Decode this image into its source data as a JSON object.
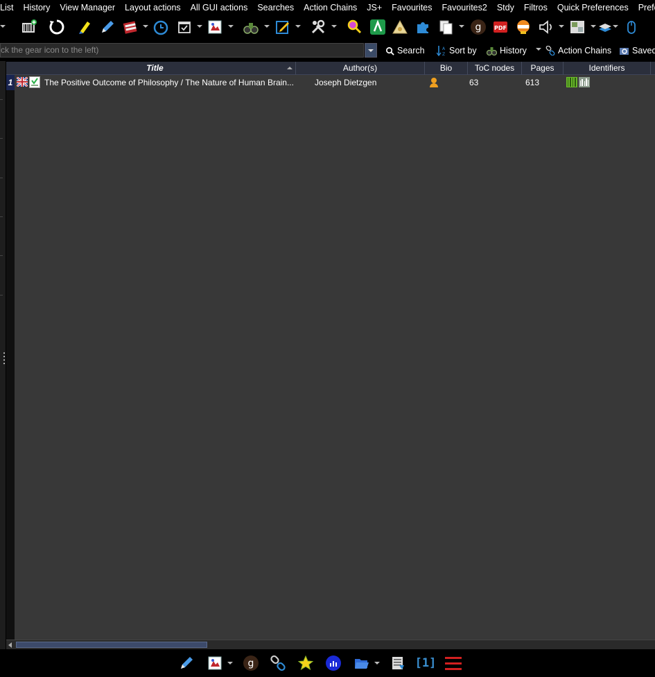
{
  "menu": [
    "List",
    "History",
    "View Manager",
    "Layout actions",
    "All GUI actions",
    "Searches",
    "Action Chains",
    "JS+",
    "Favourites",
    "Favourites2",
    "Stdy",
    "Filtros",
    "Quick Preferences",
    "Preferences"
  ],
  "toolbar": {
    "icons": [
      "add-barcode-icon",
      "refresh-icon",
      "highlighter-icon",
      "pencil-icon",
      "books-icon",
      "clock-icon",
      "calendar-check-icon",
      "image-gallery-icon",
      "binoculars-icon",
      "edit-note-icon",
      "tools-icon",
      "magnifier-icon",
      "green-app-icon",
      "warning-triangle-icon",
      "puzzle-icon",
      "copy-pages-icon",
      "goodreads-icon",
      "pdf-icon",
      "badge-icon",
      "speaker-icon",
      "image-thumbnail-icon",
      "layers-icon",
      "mouse-icon"
    ],
    "pdf_label": "PDF",
    "goodreads_label": "g"
  },
  "search": {
    "placeholder": "ck the gear icon to the left)",
    "search_label": "Search",
    "sort_label": "Sort by",
    "history_label": "History",
    "action_chains_label": "Action Chains",
    "saved_label": "Saved"
  },
  "grid": {
    "columns": [
      "Title",
      "Author(s)",
      "Bio",
      "ToC nodes",
      "Pages",
      "Identifiers"
    ],
    "rows": [
      {
        "num": "1",
        "title": "The Positive Outcome of Philosophy / The Nature of Human Brain...",
        "author": "Joseph Dietzgen",
        "toc_nodes": "63",
        "pages": "613"
      }
    ]
  },
  "bottombar": {
    "goodreads_label": "g",
    "counter_label": "[1]"
  },
  "colors": {
    "background": "#000000",
    "grid_body": "#383838",
    "header": "#2b2f3c",
    "accent_blue": "#2e8bd6",
    "counter_blue": "#3a8fd0",
    "menu_red": "#d22020"
  }
}
